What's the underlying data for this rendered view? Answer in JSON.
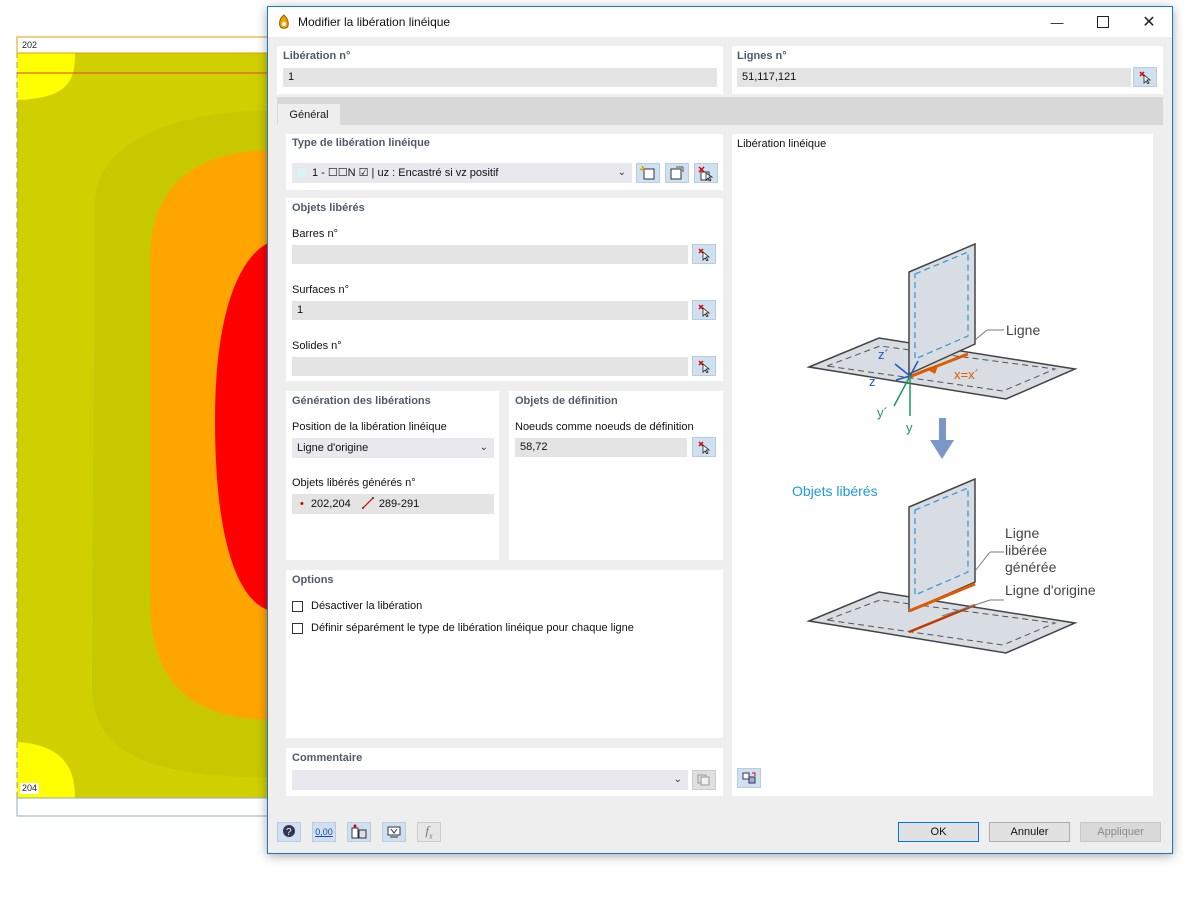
{
  "background": {
    "node_top": "202",
    "node_bottom": "204",
    "colors": {
      "red": "#ff0000",
      "orange": "#ffa500",
      "olive": "#c8c800",
      "oliveDark": "#cfcf00",
      "yellow": "#ffff00"
    }
  },
  "dialog": {
    "title": "Modifier la libération linéique",
    "release_no_label": "Libération n°",
    "release_no_value": "1",
    "lines_no_label": "Lignes n°",
    "lines_no_value": "51,117,121",
    "tab_general": "Général",
    "release_type": {
      "label": "Type de libération linéique",
      "value": "1 - ☐☐N ☑ | uz : Encastré si vz positif"
    },
    "released_objects": {
      "label": "Objets libérés",
      "members_label": "Barres n°",
      "members_value": "",
      "surfaces_label": "Surfaces n°",
      "surfaces_value": "1",
      "solids_label": "Solides n°",
      "solids_value": ""
    },
    "generation": {
      "label": "Génération des libérations",
      "position_label": "Position de la libération linéique",
      "position_value": "Ligne d'origine",
      "generated_label": "Objets libérés générés n°",
      "generated_nodes": "202,204",
      "generated_lines": "289-291"
    },
    "definition": {
      "label": "Objets de définition",
      "nodes_label": "Noeuds comme noeuds de définition",
      "nodes_value": "58,72"
    },
    "options": {
      "label": "Options",
      "deactivate": "Désactiver la libération",
      "separate": "Définir séparément le type de libération linéique pour chaque ligne"
    },
    "comment": {
      "label": "Commentaire",
      "value": ""
    },
    "preview": {
      "title": "Libération linéique",
      "ligne": "Ligne",
      "x_axis": "x=x´",
      "z_prime": "z´",
      "z": "z",
      "y_prime": "y´",
      "y": "y",
      "released_objects": "Objets libérés",
      "generated_line_1": "Ligne",
      "generated_line_2": "libérée",
      "generated_line_3": "générée",
      "origin_line": "Ligne d'origine"
    },
    "buttons": {
      "ok": "OK",
      "cancel": "Annuler",
      "apply": "Appliquer"
    },
    "bottom_zero": "0,00"
  }
}
